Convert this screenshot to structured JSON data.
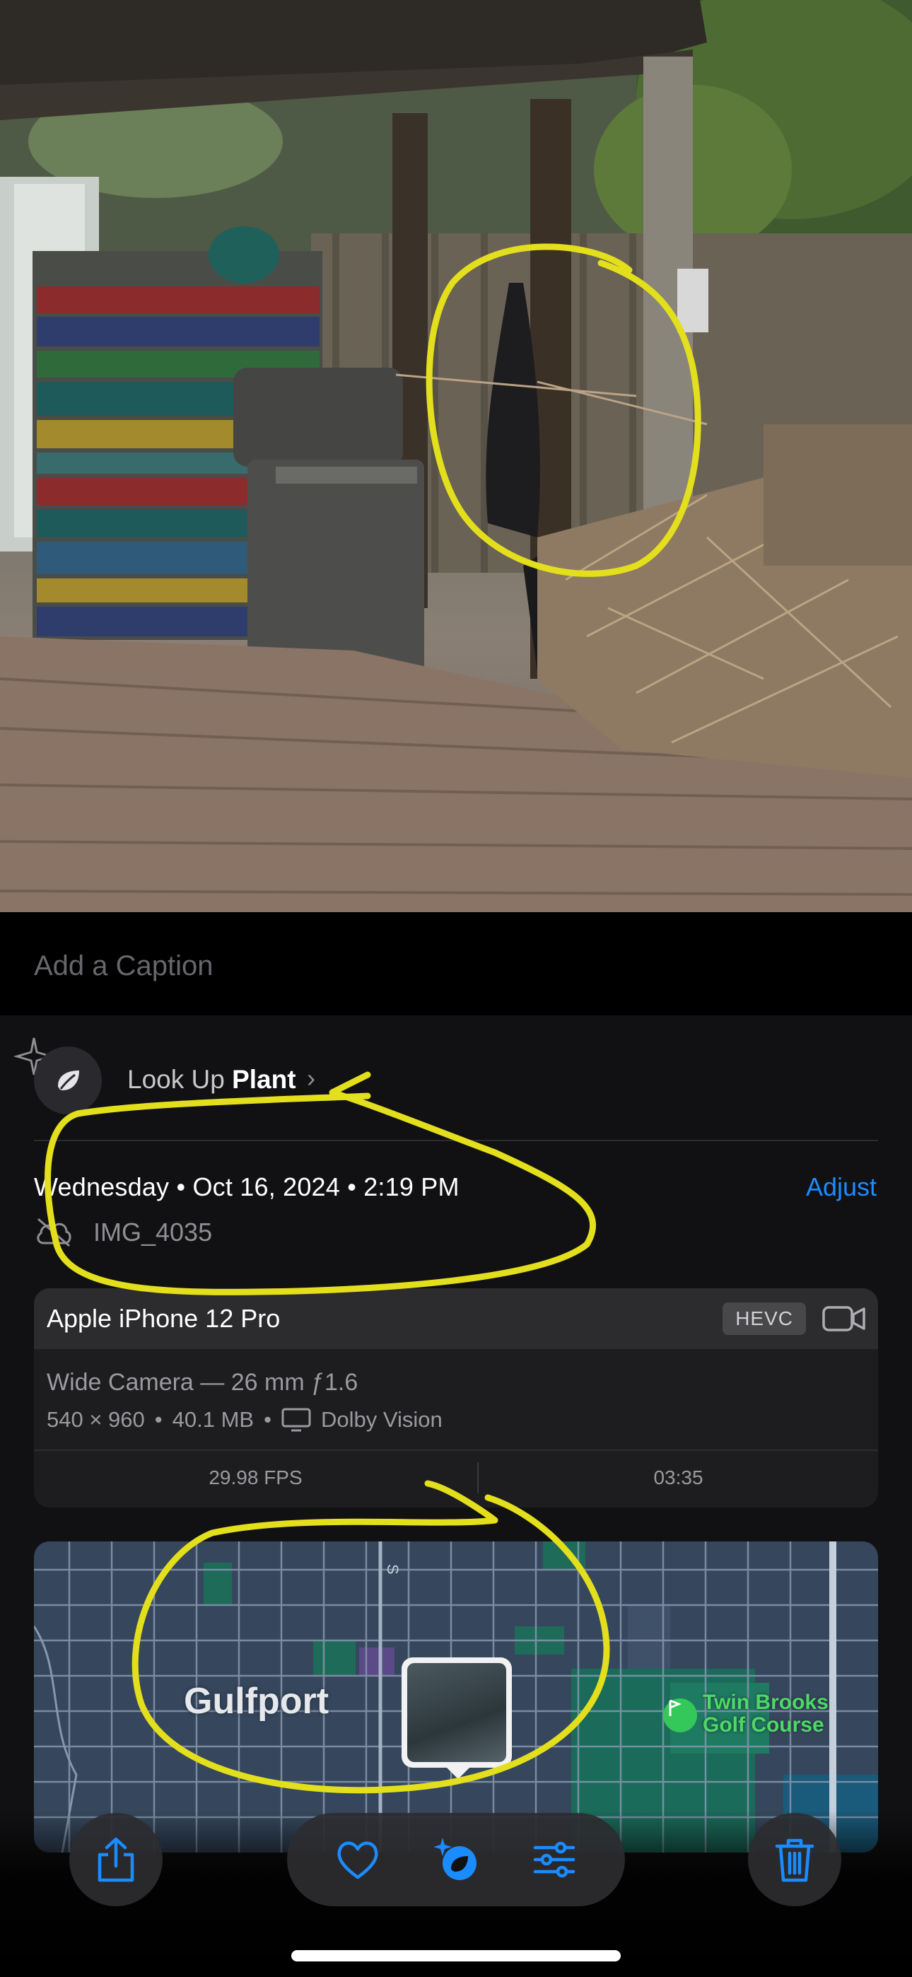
{
  "caption": {
    "placeholder": "Add a Caption",
    "value": ""
  },
  "lookup": {
    "prefix": "Look Up ",
    "subject": "Plant",
    "icon": "leaf-icon"
  },
  "metadata": {
    "date_line": "Wednesday • Oct 16, 2024 • 2:19 PM",
    "adjust_label": "Adjust",
    "filename": "IMG_4035",
    "sync_status_icon": "cloud-slash-icon"
  },
  "camera": {
    "device": "Apple iPhone 12 Pro",
    "codec_badge": "HEVC",
    "media_type_icon": "video-camera-icon",
    "lens": "Wide Camera — 26 mm ƒ1.6",
    "resolution": "540 × 960",
    "file_size": "40.1 MB",
    "hdr": "Dolby Vision",
    "fps": "29.98 FPS",
    "duration": "03:35"
  },
  "map": {
    "place": "Gulfport",
    "poi_line1": "Twin Brooks",
    "poi_line2": "Golf Course",
    "street_label": "S"
  },
  "toolbar": {
    "share_icon": "share-icon",
    "favorite_icon": "heart-icon",
    "visual_lookup_icon": "visual-lookup-icon",
    "edit_icon": "sliders-icon",
    "delete_icon": "trash-icon"
  },
  "colors": {
    "accent": "#1a8cff",
    "annotation": "#e3df1c",
    "golf_green": "#34c759"
  }
}
